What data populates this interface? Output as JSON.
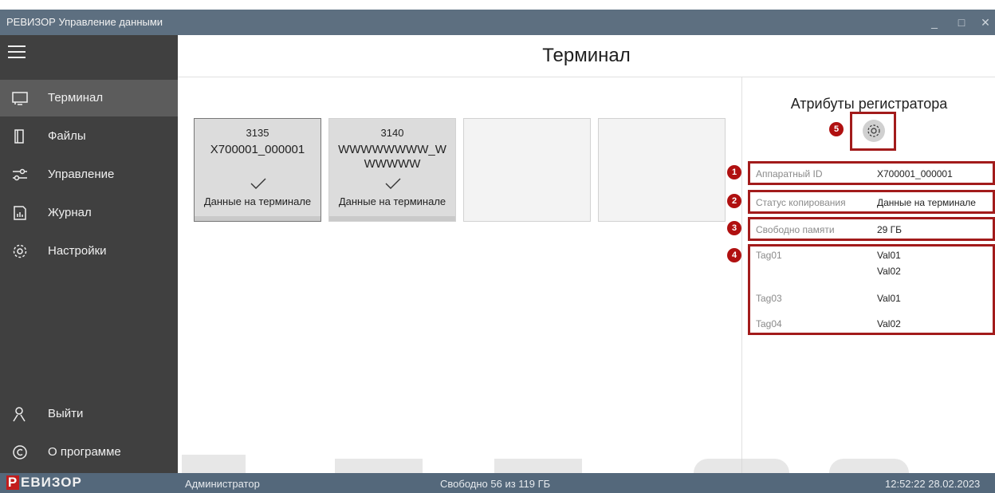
{
  "window": {
    "title": "РЕВИЗОР Управление данными",
    "minimize_glyph": "_",
    "maximize_glyph": "□",
    "close_glyph": "✕"
  },
  "sidebar": {
    "menu_icon": "hamburger-icon",
    "items": [
      {
        "label": "Терминал",
        "icon": "terminal-icon",
        "active": true
      },
      {
        "label": "Файлы",
        "icon": "file-icon"
      },
      {
        "label": "Управление",
        "icon": "sliders-icon"
      },
      {
        "label": "Журнал",
        "icon": "journal-icon"
      },
      {
        "label": "Настройки",
        "icon": "gear-icon"
      }
    ],
    "bottom_items": [
      {
        "label": "Выйти",
        "icon": "user-icon"
      },
      {
        "label": "О программе",
        "icon": "copyright-icon"
      }
    ]
  },
  "header": {
    "title": "Терминал"
  },
  "slots": [
    {
      "number": "3135",
      "id": "X700001_000001",
      "check": "✓",
      "status": "Данные на терминале"
    },
    {
      "number": "3140",
      "id": "WWWWWWWW_WWWWWW",
      "check": "✓",
      "status": "Данные на терминале"
    },
    {},
    {}
  ],
  "attributes": {
    "title": "Атрибуты регистратора",
    "settings_icon": "gear-icon",
    "hardware_id": {
      "key": "Аппаратный ID",
      "value": "X700001_000001"
    },
    "copy_status": {
      "key": "Статус копирования",
      "value": "Данные на терминале"
    },
    "free_memory": {
      "key": "Свободно памяти",
      "value": "29 ГБ"
    },
    "tags": [
      {
        "key": "Tag01",
        "value": "Val01"
      },
      {
        "key": "",
        "value": "Val02"
      },
      {
        "key": "Tag03",
        "value": "Val01"
      },
      {
        "key": "Tag04",
        "value": "Val02"
      }
    ],
    "badges": [
      "1",
      "2",
      "3",
      "4",
      "5"
    ]
  },
  "statusbar": {
    "logo_p": "Р",
    "logo_rest": "ЕВИЗОР",
    "user": "Администратор",
    "storage": "Свободно 56 из 119 ГБ",
    "datetime": "12:52:22 28.02.2023"
  },
  "colors": {
    "sidebar_bg": "#404040",
    "sidebar_active": "#5c5c5c",
    "titlebar_bg": "#5d6f80",
    "statusbar_bg": "#54687b",
    "annotation_red": "#a21b1b",
    "brand_red": "#c21d1d"
  }
}
